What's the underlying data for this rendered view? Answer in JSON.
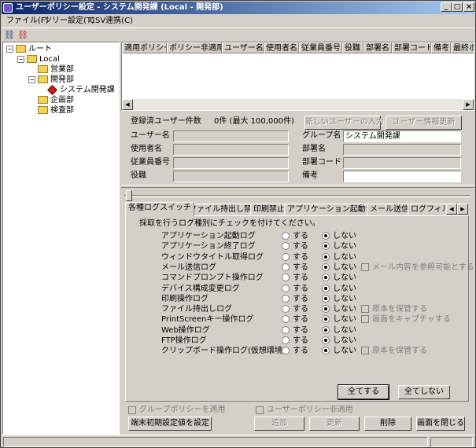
{
  "window": {
    "title": "ユーザーポリシー設定 - システム開発課 (Local - 開発部)"
  },
  "menu": [
    {
      "label": "ファイル(F)"
    },
    {
      "label": "ツリー設定(T)"
    },
    {
      "label": "CSV連携(C)"
    }
  ],
  "tree": {
    "root": "ルート",
    "local": "Local",
    "sales": "営業部",
    "dev": "開発部",
    "sysdev": "システム開発課",
    "planning": "企画部",
    "inspection": "検査部"
  },
  "grid": {
    "columns": [
      "適用ポリシー",
      "ポリシー非適用",
      "ユーザー名",
      "使用者名",
      "従業員番号",
      "役職",
      "部署名",
      "部署コード",
      "備考",
      "最終ポ"
    ]
  },
  "info": {
    "registered_label": "登録済ユーザー件数",
    "registered_count": "0件 (最大 100,000件)",
    "new_user_button": "新しいユーザーの入力",
    "update_user_button": "ユーザー情報更新",
    "username_label": "ユーザー名",
    "user_label": "使用者名",
    "employee_no_label": "従業員番号",
    "position_label": "役職",
    "group_label": "グループ名",
    "group_value": "システム開発課",
    "dept_label": "部署名",
    "dept_code_label": "部署コード",
    "note_label": "備考"
  },
  "tabs": [
    {
      "label": "各種ログスイッチ"
    },
    {
      "label": "ファイル持出し禁止"
    },
    {
      "label": "印刷禁止"
    },
    {
      "label": "アプリケーション起動禁止"
    },
    {
      "label": "メール送信"
    },
    {
      "label": "ログフィル"
    }
  ],
  "log_panel": {
    "instruction": "採取を行うログ種別にチェックを付けてください。",
    "on_label": "する",
    "off_label": "しない",
    "rows": [
      {
        "label": "アプリケーション起動ログ",
        "value": "off"
      },
      {
        "label": "アプリケーション終了ログ",
        "value": "off"
      },
      {
        "label": "ウィンドウタイトル取得ログ",
        "value": "off"
      },
      {
        "label": "メール送信ログ",
        "value": "off",
        "extra": "メール内容を参照可能とする"
      },
      {
        "label": "コマンドプロンプト操作ログ",
        "value": "off"
      },
      {
        "label": "デバイス構成変更ログ",
        "value": "off"
      },
      {
        "label": "印刷操作ログ",
        "value": "off"
      },
      {
        "label": "ファイル持出しログ",
        "value": "off",
        "extra": "原本を保管する"
      },
      {
        "label": "PrintScreenキー操作ログ",
        "value": "off",
        "extra": "画面をキャプチャする"
      },
      {
        "label": "Web操作ログ",
        "value": "off"
      },
      {
        "label": "FTP操作ログ",
        "value": "off"
      },
      {
        "label": "クリップボード操作ログ(仮想環境)",
        "value": "off",
        "extra": "原本を保管する"
      }
    ],
    "all_on_button": "全てする",
    "all_off_button": "全てしない"
  },
  "bottom": {
    "group_policy_checkbox": "グループポリシーを適用",
    "user_policy_checkbox": "ユーザーポリシー非適用",
    "terminal_default_button": "端末初期設定値を設定",
    "add_button": "追加",
    "update_button": "更新",
    "delete_button": "削除",
    "close_button": "画面を閉じる"
  },
  "colors": {
    "title_start": "#0a246a",
    "title_end": "#a6caf0",
    "face": "#d4d0c8"
  }
}
